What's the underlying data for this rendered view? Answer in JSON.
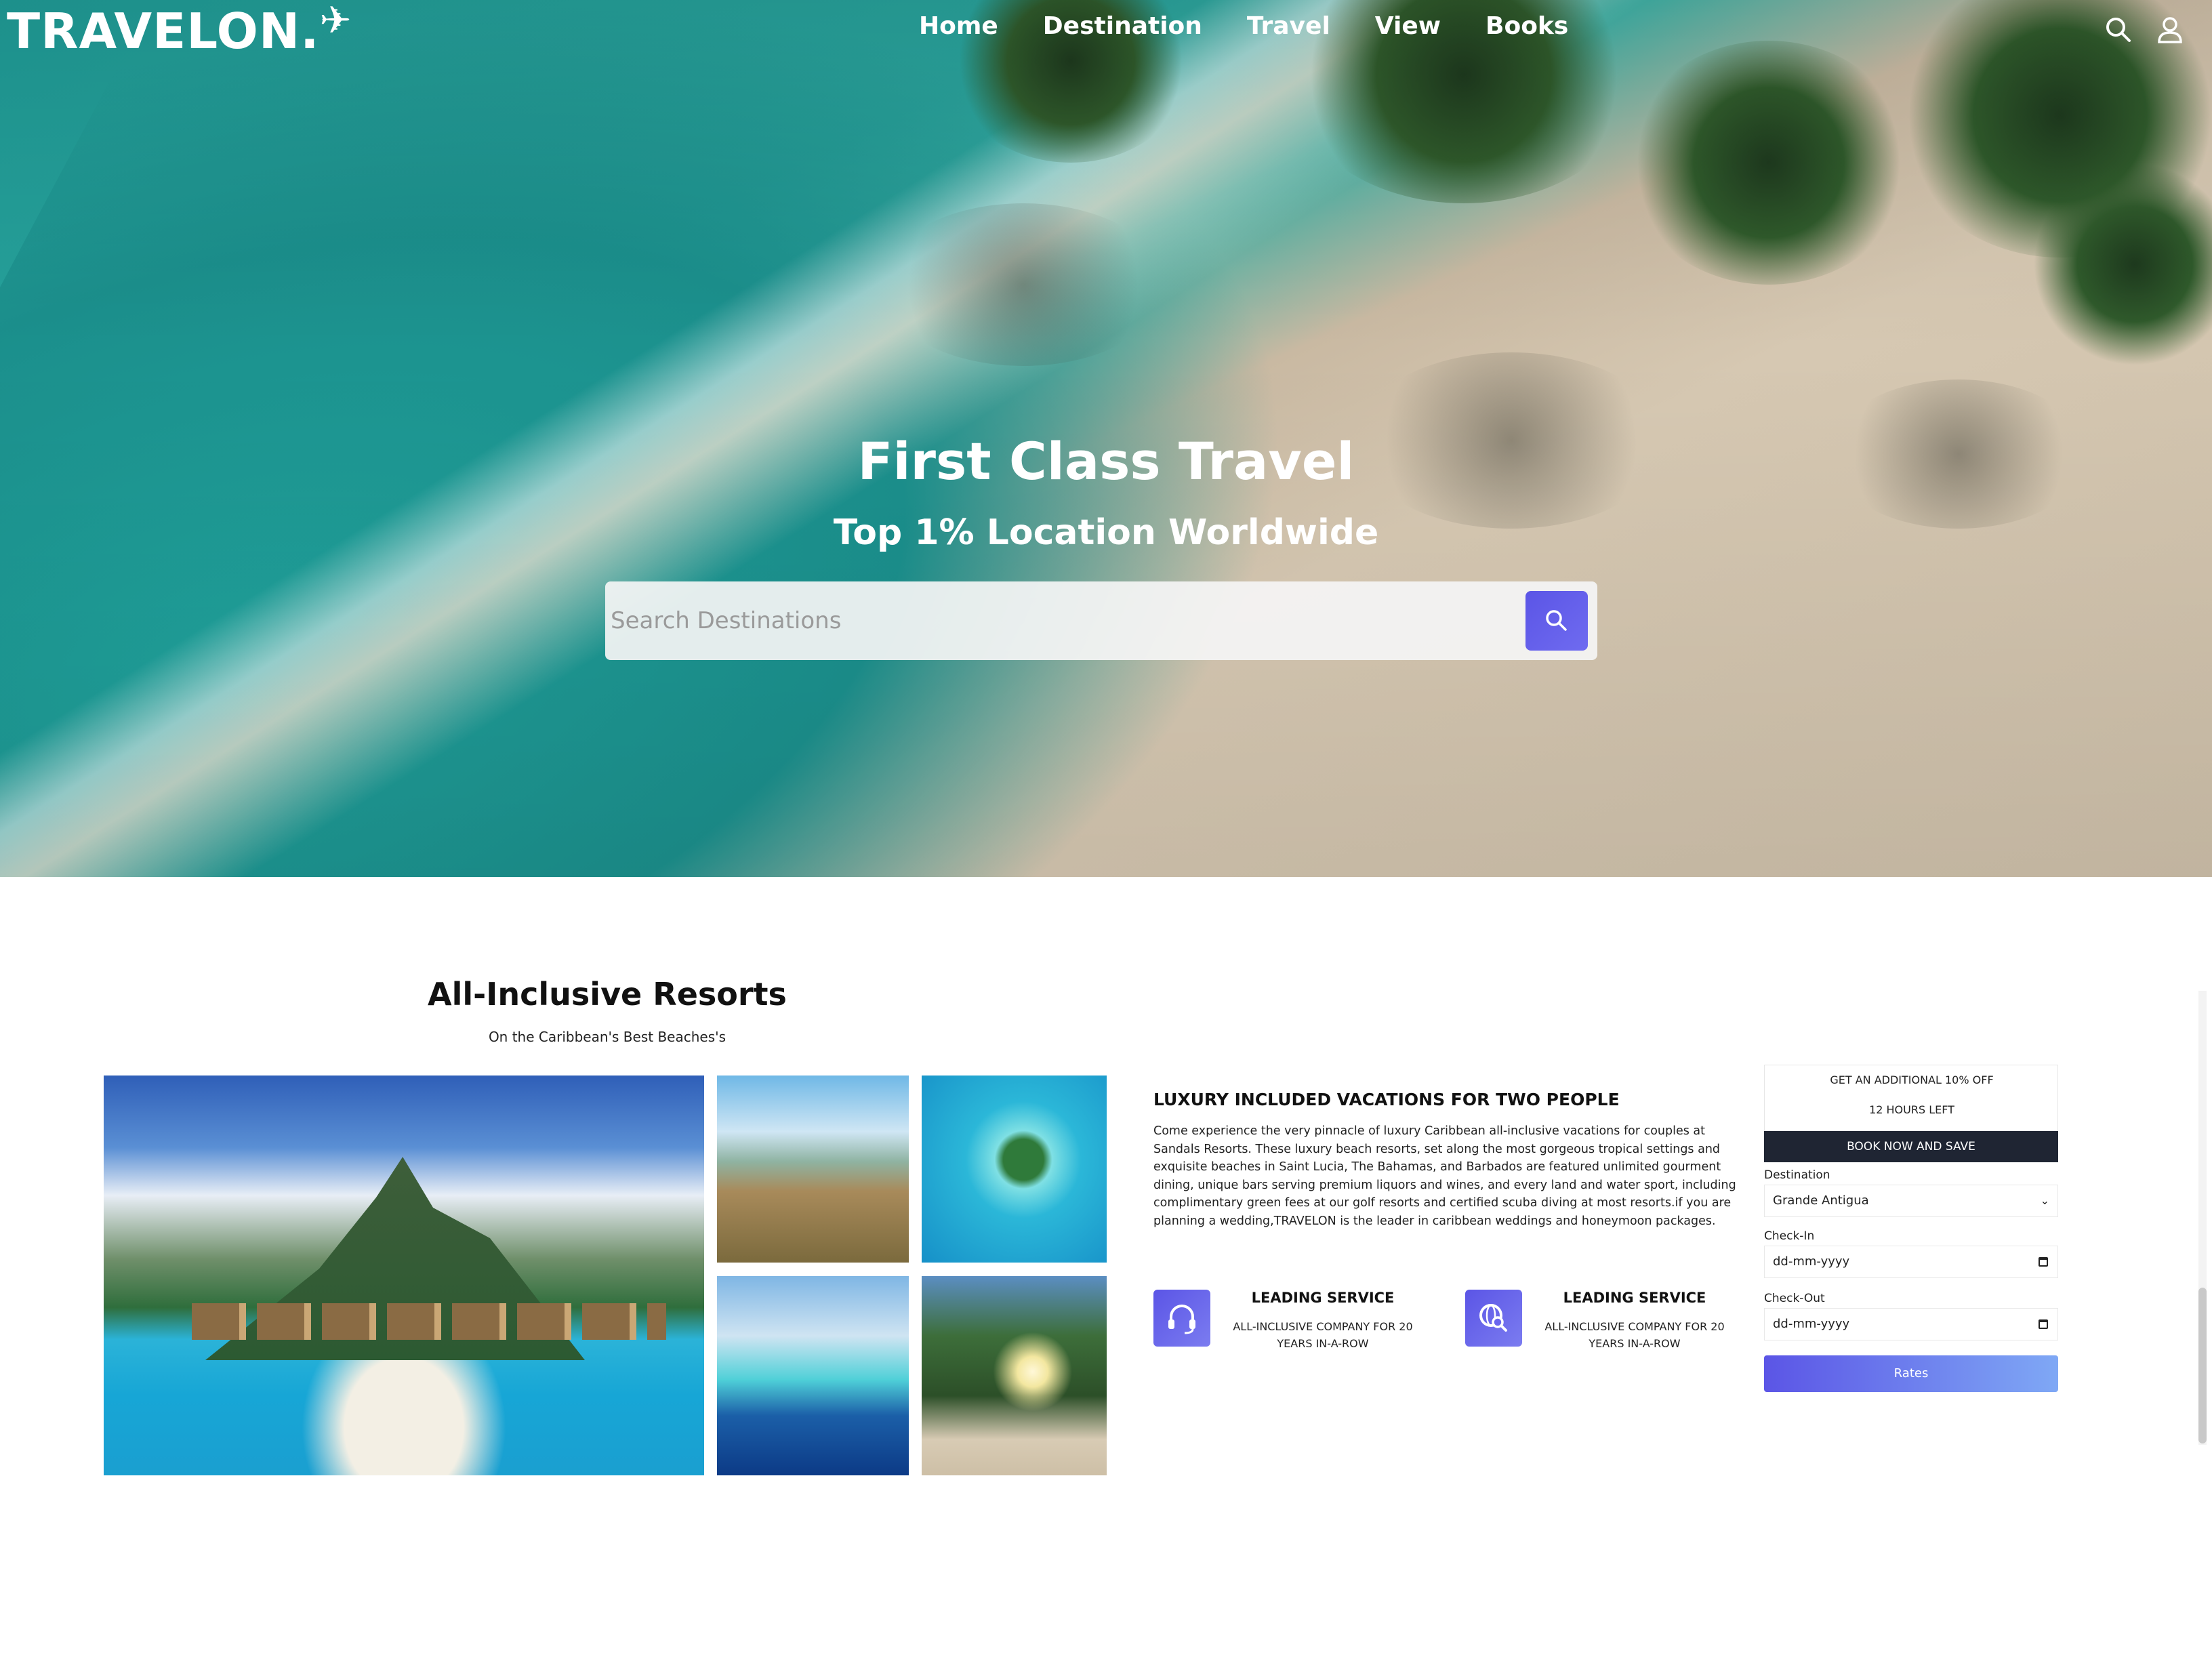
{
  "brand": {
    "logo_text": "TRAVELON.",
    "logo_icon": "airplane-icon"
  },
  "nav": {
    "items": [
      "Home",
      "Destination",
      "Travel",
      "View",
      "Books"
    ],
    "icons": [
      "search-icon",
      "user-icon"
    ]
  },
  "hero": {
    "title": "First Class Travel",
    "subtitle": "Top 1% Location Worldwide",
    "search_placeholder": "Search Destinations"
  },
  "resorts": {
    "title": "All-Inclusive Resorts",
    "subtitle": "On the Caribbean's Best Beaches's"
  },
  "vacation": {
    "title": "LUXURY INCLUDED VACATIONS FOR TWO PEOPLE",
    "body": "Come experience the very pinnacle of luxury Caribbean all-inclusive vacations for couples at Sandals Resorts. These luxury beach resorts, set along the most gorgeous tropical settings and exquisite beaches in Saint Lucia, The Bahamas, and Barbados are featured unlimited gourment dining, unique bars serving premium liquors and wines, and every land and water sport, including complimentary green fees at our golf resorts and certified scuba diving at most resorts.if you are planning a wedding,TRAVELON is the leader in caribbean weddings and honeymoon packages."
  },
  "features": [
    {
      "icon": "headset-icon",
      "title": "LEADING SERVICE",
      "desc": "ALL-INCLUSIVE COMPANY FOR 20 YEARS IN-A-ROW"
    },
    {
      "icon": "globe-search-icon",
      "title": "LEADING SERVICE",
      "desc": "ALL-INCLUSIVE COMPANY FOR 20 YEARS IN-A-ROW"
    }
  ],
  "booking": {
    "offer": "GET AN ADDITIONAL 10% OFF",
    "time_left": "12 HOURS LEFT",
    "book_button": "BOOK NOW AND SAVE",
    "destination_label": "Destination",
    "destination_value": "Grande Antigua",
    "checkin_label": "Check-In",
    "checkin_value": "dd-mm-yyyy",
    "checkout_label": "Check-Out",
    "checkout_value": "dd-mm-yyyy",
    "rates_button": "Rates"
  },
  "colors": {
    "accent": "#5b55e6",
    "dark_button": "#1f2533",
    "hero_sea": "#1f9c97",
    "hero_sand": "#d6c8b2"
  }
}
